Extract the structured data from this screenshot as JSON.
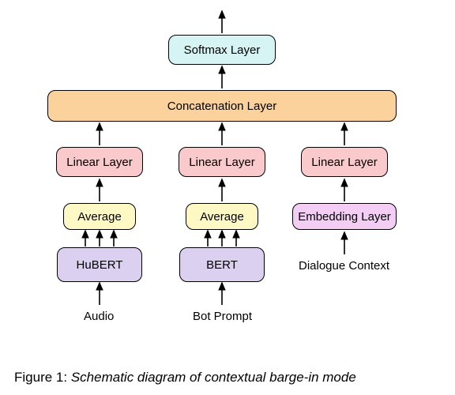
{
  "blocks": {
    "softmax": "Softmax Layer",
    "concat": "Concatenation Layer",
    "linear1": "Linear Layer",
    "linear2": "Linear Layer",
    "linear3": "Linear Layer",
    "avg1": "Average",
    "avg2": "Average",
    "embed": "Embedding Layer",
    "enc1": "HuBERT",
    "enc2": "BERT"
  },
  "inputs": {
    "audio": "Audio",
    "prompt": "Bot Prompt",
    "context": "Dialogue Context"
  },
  "caption": {
    "label": "Figure 1:",
    "text": "Schematic diagram of contextual barge-in mode"
  }
}
